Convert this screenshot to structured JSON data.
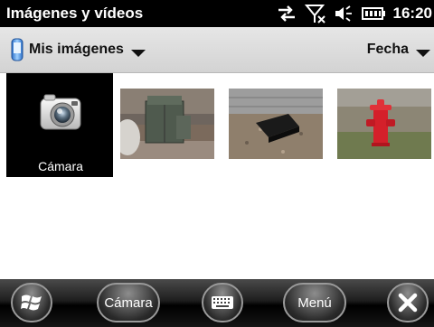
{
  "status_bar": {
    "title": "Imágenes y vídeos",
    "time": "16:20",
    "icons": [
      "sync-icon",
      "no-signal-icon",
      "volume-icon",
      "battery-icon"
    ]
  },
  "filter_bar": {
    "folder_label": "Mis imágenes",
    "sort_label": "Fecha",
    "icons": [
      "phone-icon",
      "dropdown-caret-icon"
    ]
  },
  "grid": {
    "items": [
      {
        "caption": "Cámara",
        "type": "camera",
        "selected": true
      },
      {
        "caption": "",
        "type": "photo",
        "subject": "utility box"
      },
      {
        "caption": "",
        "type": "photo",
        "subject": "black box on gravel"
      },
      {
        "caption": "",
        "type": "photo",
        "subject": "red fire hydrant"
      }
    ]
  },
  "soft_bar": {
    "start_icon": "windows-start-icon",
    "left_softkey": "Cámara",
    "keyboard_icon": "keyboard-icon",
    "right_softkey": "Menú",
    "close_icon": "close-icon"
  },
  "colors": {
    "status_bg": "#000000",
    "filter_bg": "#dcdcdc",
    "selected_tile": "#000000",
    "softbar_bg": "#1e1e1e"
  }
}
